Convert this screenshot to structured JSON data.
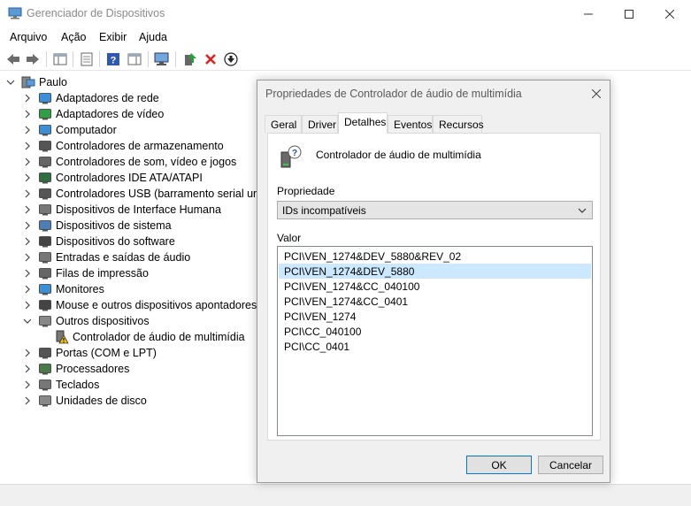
{
  "window": {
    "title": "Gerenciador de Dispositivos",
    "menu": [
      "Arquivo",
      "Ação",
      "Exibir",
      "Ajuda"
    ]
  },
  "toolbar": {
    "icons": [
      "back-arrow-icon",
      "forward-arrow-icon",
      "show-hide-console-tree-icon",
      "properties-icon",
      "help-icon",
      "action-pane-icon",
      "scan-hardware-icon",
      "update-driver-icon",
      "uninstall-device-icon",
      "disable-device-icon"
    ]
  },
  "tree": {
    "root": "Paulo",
    "items": [
      {
        "label": "Adaptadores de rede",
        "icon": "network-adapter-icon"
      },
      {
        "label": "Adaptadores de vídeo",
        "icon": "display-adapter-icon"
      },
      {
        "label": "Computador",
        "icon": "computer-icon"
      },
      {
        "label": "Controladores de armazenamento",
        "icon": "storage-controller-icon"
      },
      {
        "label": "Controladores de som, vídeo e jogos",
        "icon": "sound-icon"
      },
      {
        "label": "Controladores IDE ATA/ATAPI",
        "icon": "ide-controller-icon"
      },
      {
        "label": "Controladores USB (barramento serial universal)",
        "icon": "usb-icon"
      },
      {
        "label": "Dispositivos de Interface Humana",
        "icon": "hid-icon"
      },
      {
        "label": "Dispositivos de sistema",
        "icon": "system-devices-icon"
      },
      {
        "label": "Dispositivos do software",
        "icon": "software-device-icon"
      },
      {
        "label": "Entradas e saídas de áudio",
        "icon": "audio-io-icon"
      },
      {
        "label": "Filas de impressão",
        "icon": "printer-icon"
      },
      {
        "label": "Monitores",
        "icon": "monitor-icon"
      },
      {
        "label": "Mouse e outros dispositivos apontadores",
        "icon": "mouse-icon"
      },
      {
        "label": "Outros dispositivos",
        "icon": "other-devices-icon",
        "expanded": true
      },
      {
        "label": "Controlador de áudio de multimídia",
        "icon": "warning-device-icon",
        "child": true
      },
      {
        "label": "Portas (COM e LPT)",
        "icon": "port-icon"
      },
      {
        "label": "Processadores",
        "icon": "processor-icon"
      },
      {
        "label": "Teclados",
        "icon": "keyboard-icon"
      },
      {
        "label": "Unidades de disco",
        "icon": "disk-drive-icon"
      }
    ]
  },
  "dialog": {
    "title": "Propriedades de Controlador de áudio de multimídia",
    "tabs": [
      "Geral",
      "Driver",
      "Detalhes",
      "Eventos",
      "Recursos"
    ],
    "active_tab": "Detalhes",
    "device_name": "Controlador de áudio de multimídia",
    "property_label": "Propriedade",
    "property_value": "IDs incompatíveis",
    "value_label": "Valor",
    "values": [
      "PCI\\VEN_1274&DEV_5880&REV_02",
      "PCI\\VEN_1274&DEV_5880",
      "PCI\\VEN_1274&CC_040100",
      "PCI\\VEN_1274&CC_0401",
      "PCI\\VEN_1274",
      "PCI\\CC_040100",
      "PCI\\CC_0401"
    ],
    "selected_value": "PCI\\VEN_1274&DEV_5880",
    "ok_label": "OK",
    "cancel_label": "Cancelar"
  },
  "colors": {
    "selection": "#cce8ff",
    "default_button_border": "#0078d7",
    "warning": "#f5c400"
  }
}
